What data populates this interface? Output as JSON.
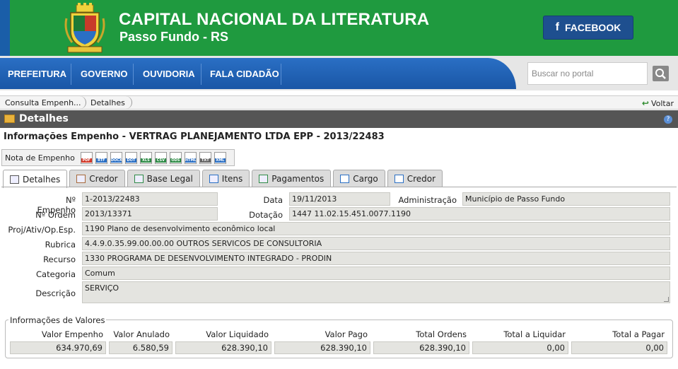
{
  "header": {
    "title": "CAPITAL NACIONAL DA LITERATURA",
    "subtitle": "Passo Fundo - RS",
    "facebook_label": "FACEBOOK"
  },
  "nav": {
    "items": [
      "PREFEITURA",
      "GOVERNO",
      "OUVIDORIA",
      "FALA CIDADÃO"
    ],
    "search_placeholder": "Buscar no portal"
  },
  "breadcrumb": {
    "items": [
      "Consulta Empenh...",
      "Detalhes"
    ],
    "back_label": "Voltar"
  },
  "section_title": "Detalhes",
  "info_heading": "Informações Empenho - VERTRAG PLANEJAMENTO LTDA EPP - 2013/22483",
  "toolbar": {
    "label": "Nota de Empenho",
    "formats": [
      {
        "tag": "PDF",
        "color": "#d23a2a"
      },
      {
        "tag": "RTF",
        "color": "#2a6fc4"
      },
      {
        "tag": "DOCX",
        "color": "#2a6fc4"
      },
      {
        "tag": "DOT",
        "color": "#2a6fc4"
      },
      {
        "tag": "XLS",
        "color": "#2e8b46"
      },
      {
        "tag": "CSV",
        "color": "#2e8b46"
      },
      {
        "tag": "ODS",
        "color": "#2e8b46"
      },
      {
        "tag": "HTML",
        "color": "#2a6fc4"
      },
      {
        "tag": "TXT",
        "color": "#666666"
      },
      {
        "tag": "XML",
        "color": "#2a6fc4"
      }
    ]
  },
  "tabs": [
    {
      "label": "Detalhes",
      "icon": "list-icon",
      "active": true
    },
    {
      "label": "Credor",
      "icon": "person-icon"
    },
    {
      "label": "Base Legal",
      "icon": "document-add-icon"
    },
    {
      "label": "Itens",
      "icon": "stack-icon"
    },
    {
      "label": "Pagamentos",
      "icon": "currency-icon"
    },
    {
      "label": "Cargo",
      "icon": "window-icon"
    },
    {
      "label": "Credor",
      "icon": "window-icon"
    }
  ],
  "form": {
    "empenho_label": "Nº Empenho",
    "empenho_value": "1-2013/22483",
    "data_label": "Data",
    "data_value": "19/11/2013",
    "administracao_label": "Administração",
    "administracao_value": "Município de Passo Fundo",
    "ordem_label": "Nº Ordem",
    "ordem_value": "2013/13371",
    "dotacao_label": "Dotação",
    "dotacao_value": "1447  11.02.15.451.0077.1190",
    "proj_label": "Proj/Ativ/Op.Esp.",
    "proj_value": "1190 Plano de desenvolvimento econômico local",
    "rubrica_label": "Rubrica",
    "rubrica_value": "4.4.9.0.35.99.00.00.00 OUTROS SERVICOS DE CONSULTORIA",
    "recurso_label": "Recurso",
    "recurso_value": "1330 PROGRAMA DE DESENVOLVIMENTO INTEGRADO - PRODIN",
    "categoria_label": "Categoria",
    "categoria_value": "Comum",
    "descricao_label": "Descrição",
    "descricao_value": "SERVIÇO"
  },
  "valores": {
    "legend": "Informações de Valores",
    "items": [
      {
        "label": "Valor Empenho",
        "value": "634.970,69"
      },
      {
        "label": "Valor Anulado",
        "value": "6.580,59"
      },
      {
        "label": "Valor Liquidado",
        "value": "628.390,10"
      },
      {
        "label": "Valor Pago",
        "value": "628.390,10"
      },
      {
        "label": "Total Ordens",
        "value": "628.390,10"
      },
      {
        "label": "Total a Liquidar",
        "value": "0,00"
      },
      {
        "label": "Total a Pagar",
        "value": "0,00"
      }
    ]
  }
}
